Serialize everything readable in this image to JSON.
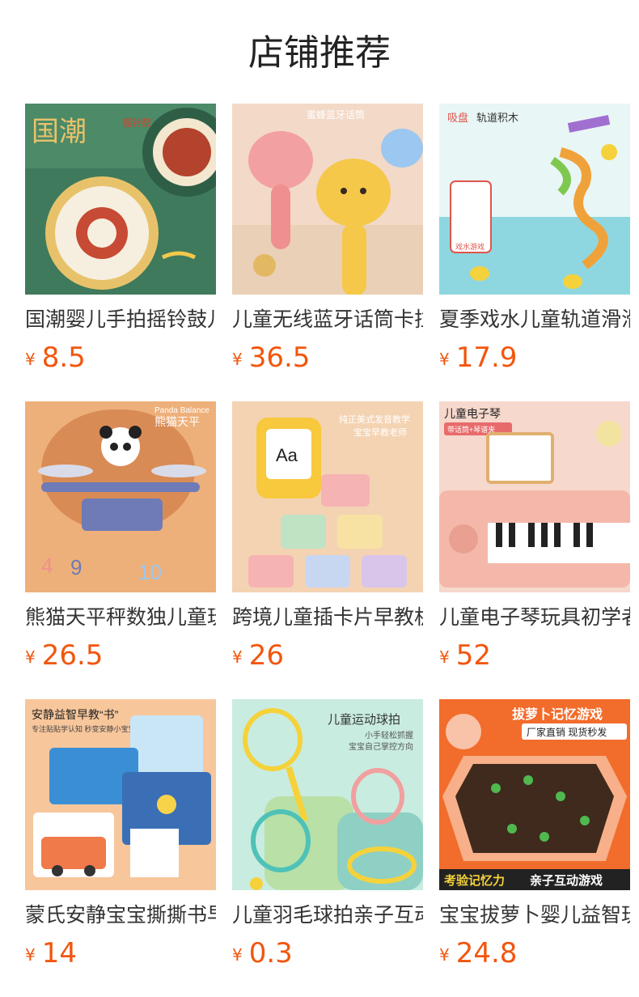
{
  "page": {
    "title": "店铺推荐"
  },
  "currency_symbol": "¥",
  "products": [
    {
      "name": "国潮婴儿手拍摇铃鼓儿童",
      "price": "8.5",
      "image_text": [
        "国潮",
        "摇铃鼓"
      ],
      "colors": {
        "bg": "#3f7a5c",
        "accent": "#e8c26a"
      }
    },
    {
      "name": "儿童无线蓝牙话筒卡拉OK",
      "price": "36.5",
      "image_text": [
        "蜜蜂蓝牙话筒"
      ],
      "colors": {
        "bg": "#f3d9c7",
        "accent": "#f5c84a"
      }
    },
    {
      "name": "夏季戏水儿童轨道滑滑梯",
      "price": "17.9",
      "image_text": [
        "吸盘",
        "轨道积木",
        "戏水游戏"
      ],
      "colors": {
        "bg": "#8fd7e0",
        "accent": "#f0a23a"
      }
    },
    {
      "name": "熊猫天平秤数独儿童玩具",
      "price": "26.5",
      "image_text": [
        "Panda Balance",
        "熊猫天平"
      ],
      "colors": {
        "bg": "#e7a468",
        "accent": "#6f7bb6"
      }
    },
    {
      "name": "跨境儿童插卡片早教机",
      "price": "26",
      "image_text": [
        "纯正美式发音教学",
        "宝宝早教老师",
        "Aa"
      ],
      "colors": {
        "bg": "#f4d3b3",
        "accent": "#f8c83d"
      }
    },
    {
      "name": "儿童电子琴玩具初学者",
      "price": "52",
      "image_text": [
        "儿童电子琴",
        "带话筒+琴谱夹"
      ],
      "colors": {
        "bg": "#f6d8cc",
        "accent": "#e86b6b"
      }
    },
    {
      "name": "蒙氏安静宝宝撕撕书早教",
      "price": "14",
      "image_text": [
        "安静益智早教“书”",
        "专注贴贴学认知 秒变安静小宝宝"
      ],
      "colors": {
        "bg": "#f7c69b",
        "accent": "#3a8fd4"
      }
    },
    {
      "name": "儿童羽毛球拍亲子互动",
      "price": "0.3",
      "image_text": [
        "儿童运动球拍",
        "小手轻松抓握",
        "宝宝自己掌控方向"
      ],
      "colors": {
        "bg": "#c9ece0",
        "accent": "#f5d23b"
      }
    },
    {
      "name": "宝宝拔萝卜婴儿益智玩具",
      "price": "24.8",
      "image_text": [
        "拔萝卜记忆游戏",
        "厂家直销 现货秒发",
        "考验记忆力",
        "亲子互动游戏"
      ],
      "colors": {
        "bg": "#f26c2b",
        "accent": "#3f2a1d"
      }
    }
  ]
}
